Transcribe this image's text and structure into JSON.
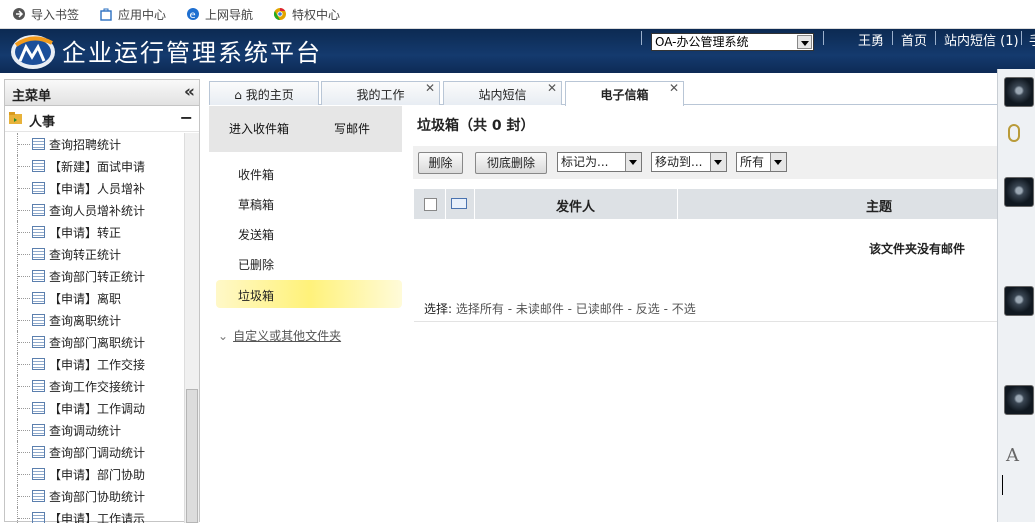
{
  "bookmarks": [
    {
      "label": "导入书签",
      "icon": "import-icon"
    },
    {
      "label": "应用中心",
      "icon": "bag-icon"
    },
    {
      "label": "上网导航",
      "icon": "ie-icon"
    },
    {
      "label": "特权中心",
      "icon": "chrome-icon"
    }
  ],
  "header": {
    "title": "企业运行管理系统平台",
    "system_select": "OA-办公管理系统",
    "user": "王勇",
    "home": "首页",
    "messages": "站内短信 (1)",
    "cut_link": "手"
  },
  "left_panel": {
    "title": "主菜单",
    "collapse_glyph": "«",
    "category": "人事",
    "items": [
      "查询招聘统计",
      "【新建】面试申请",
      "【申请】人员增补",
      "查询人员增补统计",
      "【申请】转正",
      "查询转正统计",
      "查询部门转正统计",
      "【申请】离职",
      "查询离职统计",
      "查询部门离职统计",
      "【申请】工作交接",
      "查询工作交接统计",
      "【申请】工作调动",
      "查询调动统计",
      "查询部门调动统计",
      "【申请】部门协助",
      "查询部门协助统计",
      "【申请】工作请示"
    ]
  },
  "tabs": [
    {
      "label": "我的主页",
      "closable": false
    },
    {
      "label": "我的工作",
      "closable": true
    },
    {
      "label": "站内短信",
      "closable": true
    },
    {
      "label": "电子信箱",
      "closable": true,
      "active": true
    }
  ],
  "mail_nav": {
    "inbox_enter": "进入收件箱",
    "compose": "写邮件",
    "folders": [
      "收件箱",
      "草稿箱",
      "发送箱",
      "已删除",
      "垃圾箱"
    ],
    "active_folder": "垃圾箱",
    "custom": "自定义或其他文件夹"
  },
  "main": {
    "folder_title": "垃圾箱（共 0 封）",
    "toolbar": {
      "delete": "删除",
      "purge": "彻底删除",
      "mark_as": "标记为...",
      "move_to": "移动到...",
      "filter": "所有"
    },
    "columns": {
      "sender": "发件人",
      "subject": "主题"
    },
    "empty_message": "该文件夹没有邮件",
    "select_label": "选择:",
    "select_options": "选择所有 - 未读邮件 - 已读邮件 - 反选 - 不选"
  },
  "right_strip": {
    "font_glyph": "A"
  },
  "colors": {
    "header_bg": "#143a6e",
    "trash_highlight": "#fff27a",
    "table_head": "#dde1e5"
  }
}
